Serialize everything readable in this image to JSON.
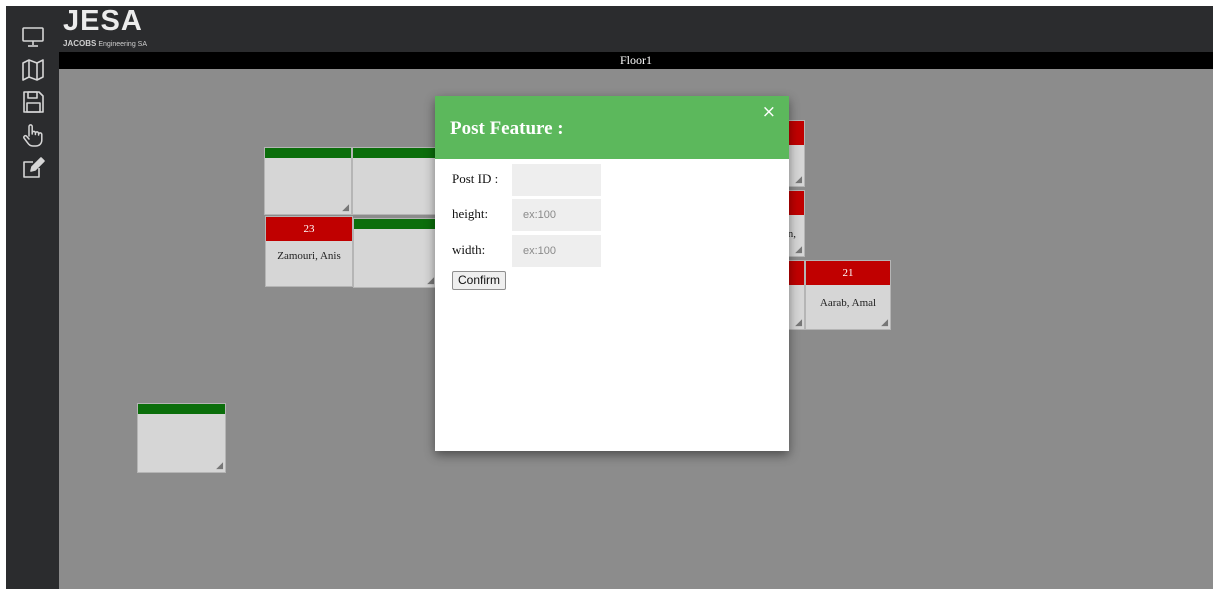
{
  "brand": {
    "logo_main": "JESA",
    "logo_sub_bold": "JACOBS",
    "logo_sub": "Engineering SA"
  },
  "sidebar": {
    "items": [
      {
        "icon": "monitor-icon"
      },
      {
        "icon": "map-icon"
      },
      {
        "icon": "floppy-save-icon"
      },
      {
        "icon": "pointer-hand-icon"
      },
      {
        "icon": "edit-icon"
      }
    ]
  },
  "floor": {
    "title": "Floor1"
  },
  "posts": [
    {
      "number": "23",
      "name": "Zamouri, Anis"
    },
    {
      "number": "21",
      "name": "Aarab, Amal"
    },
    {
      "name_fragment": "an,"
    }
  ],
  "modal": {
    "title": "Post Feature :",
    "close": "×",
    "fields": {
      "post_id_label": "Post ID :",
      "post_id_value": "",
      "height_label": "height:",
      "height_placeholder": "ex:100",
      "width_label": "width:",
      "width_placeholder": "ex:100"
    },
    "confirm_label": "Confirm"
  },
  "colors": {
    "sidebar_bg": "#2b2c2e",
    "canvas_bg": "#8c8c8c",
    "header_green": "#5cb85c",
    "post_green": "#0b6e0b",
    "post_red": "#c00000"
  }
}
